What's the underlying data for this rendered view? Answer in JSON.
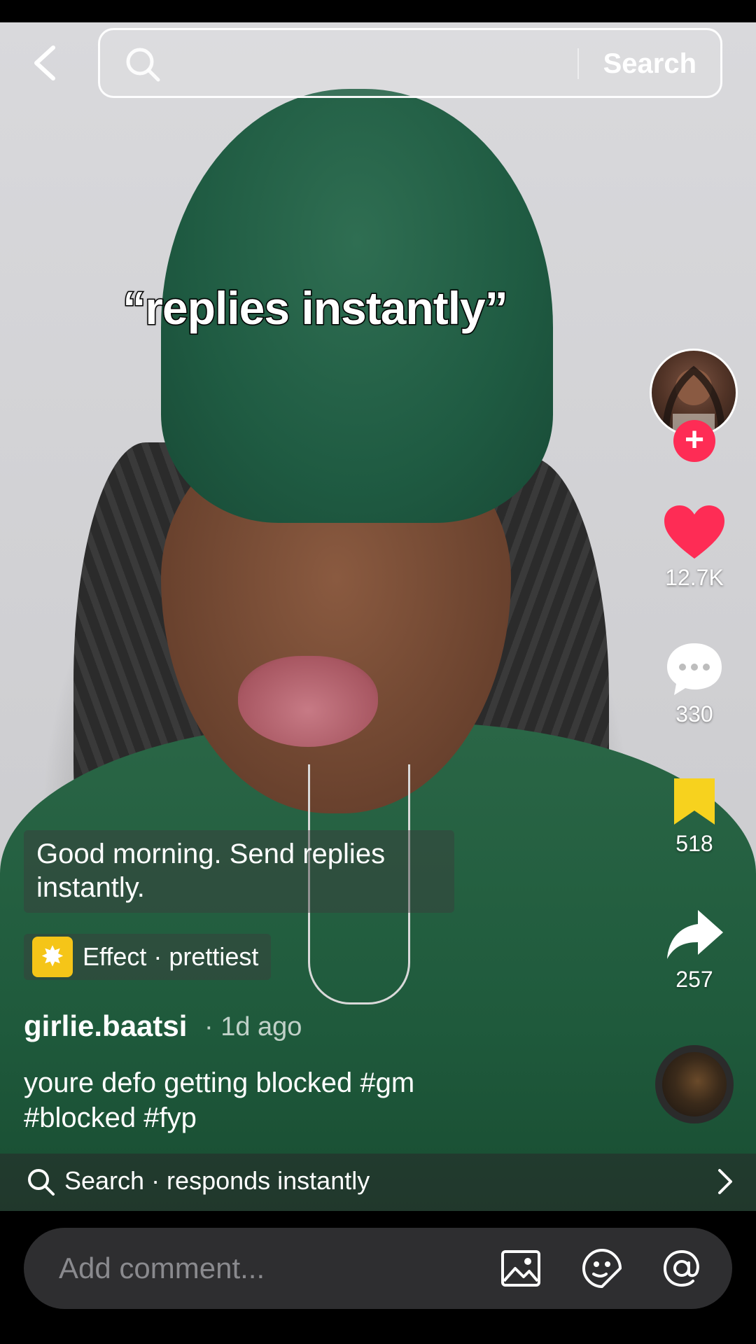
{
  "top_bar": {
    "search_button": "Search"
  },
  "video": {
    "caption": "“replies instantly”"
  },
  "actions": {
    "likes": "12.7K",
    "comments": "330",
    "saves": "518",
    "shares": "257",
    "colors": {
      "like": "#fe2c55",
      "save": "#f7d21e",
      "follow": "#fe2c55"
    }
  },
  "post": {
    "question": "Good morning. Send replies instantly.",
    "effect_label": "Effect · prettiest",
    "username": "girlie.baatsi",
    "time": "· 1d ago",
    "description": "youre defo getting blocked #gm #blocked #fyp"
  },
  "related_search": {
    "text": "Search · responds instantly"
  },
  "comment_bar": {
    "placeholder": "Add comment..."
  }
}
